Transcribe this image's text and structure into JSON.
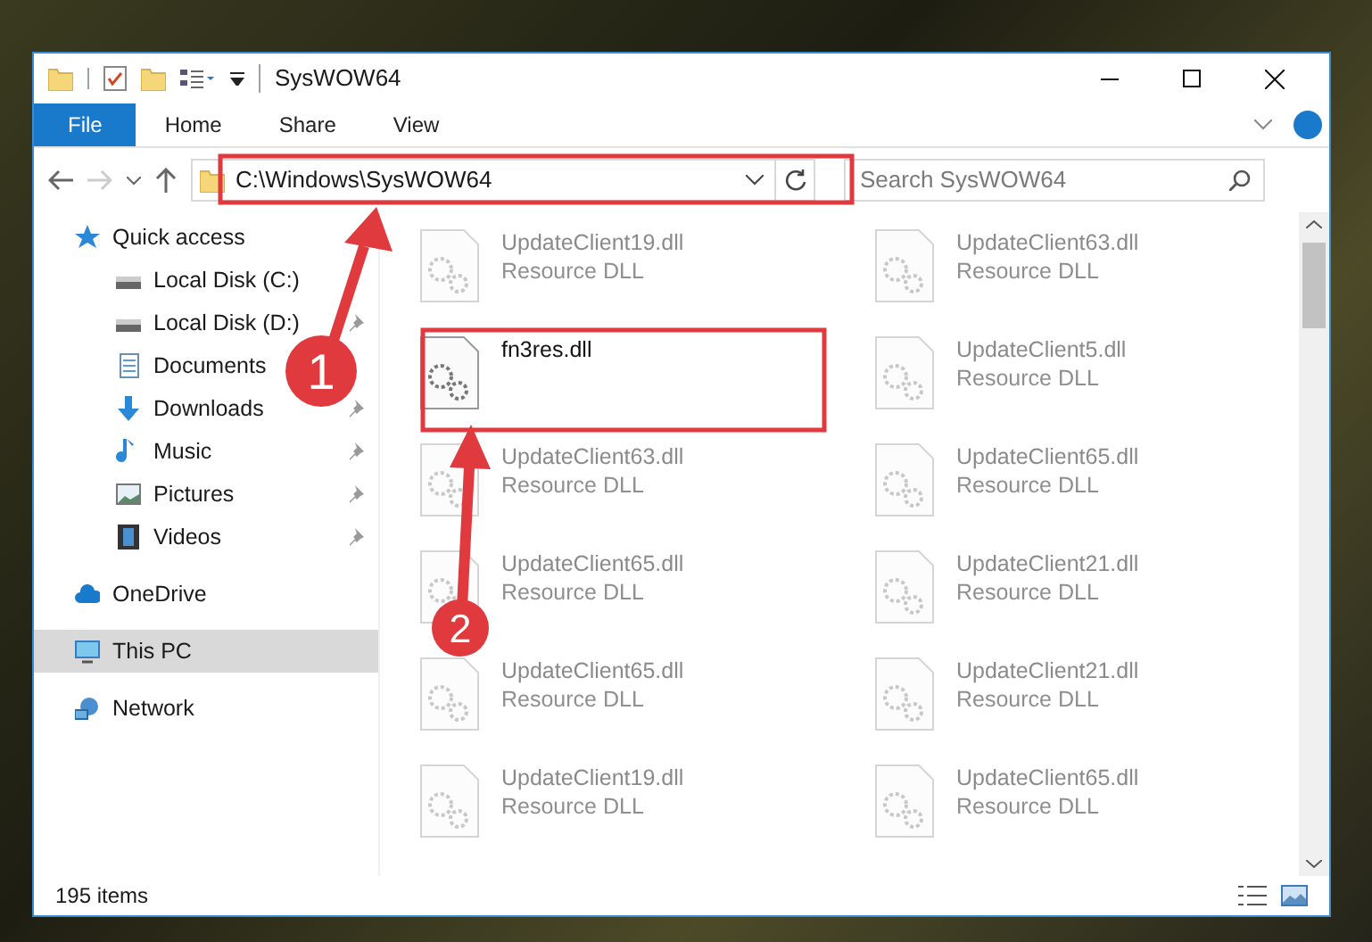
{
  "window": {
    "title": "SysWOW64"
  },
  "ribbon_tabs": [
    {
      "label": "File",
      "selected": true
    },
    {
      "label": "Home",
      "selected": false
    },
    {
      "label": "Share",
      "selected": false
    },
    {
      "label": "View",
      "selected": false
    }
  ],
  "address": {
    "path": "C:\\Windows\\SysWOW64"
  },
  "search": {
    "placeholder": "Search SysWOW64"
  },
  "sidebar": {
    "items": [
      {
        "label": "Quick access",
        "selected": false,
        "children": [
          {
            "label": "Local Disk (C:)",
            "pinned": false,
            "selected": false
          },
          {
            "label": "Local Disk (D:)",
            "pinned": true,
            "selected": false
          },
          {
            "label": "Documents",
            "pinned": false,
            "selected": false
          },
          {
            "label": "Downloads",
            "pinned": true,
            "selected": false
          },
          {
            "label": "Music",
            "pinned": true,
            "selected": false
          },
          {
            "label": "Pictures",
            "pinned": true,
            "selected": false
          },
          {
            "label": "Videos",
            "pinned": true,
            "selected": false
          }
        ]
      },
      {
        "label": "OneDrive",
        "selected": false
      },
      {
        "label": "This PC",
        "selected": true
      },
      {
        "label": "Network",
        "selected": false
      }
    ]
  },
  "files": [
    {
      "name": "UpdateClient19.dll",
      "type": "Resource DLL",
      "dimmed": true
    },
    {
      "name": "UpdateClient63.dll",
      "type": "Resource DLL",
      "dimmed": true
    },
    {
      "name": "fn3res.dll",
      "dimmed": false
    },
    {
      "name": "UpdateClient5.dll",
      "type": "Resource DLL",
      "dimmed": true
    },
    {
      "name": "UpdateClient63.dll",
      "type": "Resource DLL",
      "dimmed": true
    },
    {
      "name": "UpdateClient65.dll",
      "type": "Resource DLL",
      "dimmed": true
    },
    {
      "name": "UpdateClient65.dll",
      "type": "Resource DLL",
      "dimmed": true
    },
    {
      "name": "UpdateClient21.dll",
      "type": "Resource DLL",
      "dimmed": true
    },
    {
      "name": "UpdateClient65.dll",
      "type": "Resource DLL",
      "dimmed": true
    },
    {
      "name": "UpdateClient21.dll",
      "type": "Resource DLL",
      "dimmed": true
    },
    {
      "name": "UpdateClient19.dll",
      "type": "Resource DLL",
      "dimmed": true
    },
    {
      "name": "UpdateClient65.dll",
      "type": "Resource DLL",
      "dimmed": true
    }
  ],
  "status_bar": {
    "count": "195 items"
  },
  "annotations": [
    {
      "number": "1"
    },
    {
      "number": "2"
    }
  ]
}
